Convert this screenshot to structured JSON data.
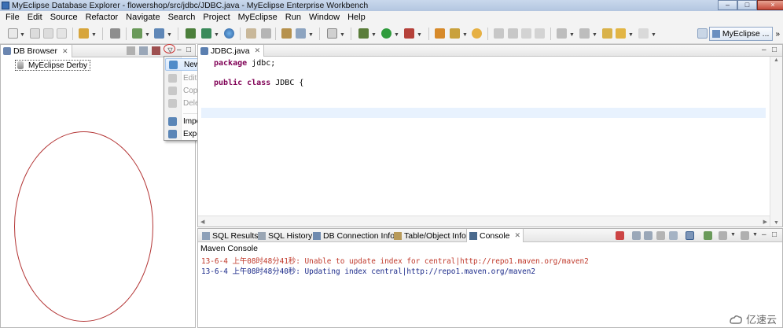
{
  "window": {
    "title": "MyEclipse Database Explorer - flowershop/src/jdbc/JDBC.java - MyEclipse Enterprise Workbench",
    "minimize": "–",
    "maximize": "□",
    "close": "×"
  },
  "menubar": [
    "File",
    "Edit",
    "Source",
    "Refactor",
    "Navigate",
    "Search",
    "Project",
    "MyEclipse",
    "Run",
    "Window",
    "Help"
  ],
  "toolbar": {
    "perspective_label": "MyEclipse ...",
    "perspective_more": "»"
  },
  "db_browser": {
    "tab_label": "DB Browser",
    "tab_close": "✕",
    "tree_items": [
      "MyEclipse Derby"
    ],
    "minimize": "–",
    "maximize": "□"
  },
  "context_menu": {
    "items": [
      {
        "label": "New...",
        "enabled": true
      },
      {
        "label": "Edit...",
        "enabled": false
      },
      {
        "label": "Copy...",
        "enabled": false
      },
      {
        "label": "Delete",
        "enabled": false
      },
      {
        "label": "Import...",
        "enabled": true
      },
      {
        "label": "Export...",
        "enabled": true
      }
    ]
  },
  "editor": {
    "tab_label": "JDBC.java",
    "tab_close": "✕",
    "line1_kw": "package",
    "line1_rest": " jdbc;",
    "line2_kw": "public class",
    "line2_rest": " JDBC {",
    "minimize": "–",
    "maximize": "□"
  },
  "console_panel": {
    "tabs": [
      "SQL Results",
      "SQL History",
      "DB Connection Info",
      "Table/Object Info",
      "Console"
    ],
    "tab_close": "✕",
    "title": "Maven Console",
    "lines": [
      {
        "text": "13-6-4 上午08时48分41秒: Unable to update index for central|http://repo1.maven.org/maven2",
        "kind": "err"
      },
      {
        "text": "13-6-4 上午08时48分40秒: Updating index central|http://repo1.maven.org/maven2",
        "kind": "info"
      }
    ],
    "minimize": "–",
    "maximize": "□"
  },
  "watermark": "亿速云",
  "colors": {
    "keyword": "#7f0055",
    "error_text": "#c0392b",
    "info_text": "#1b2a8a",
    "annotation": "#b33434"
  }
}
